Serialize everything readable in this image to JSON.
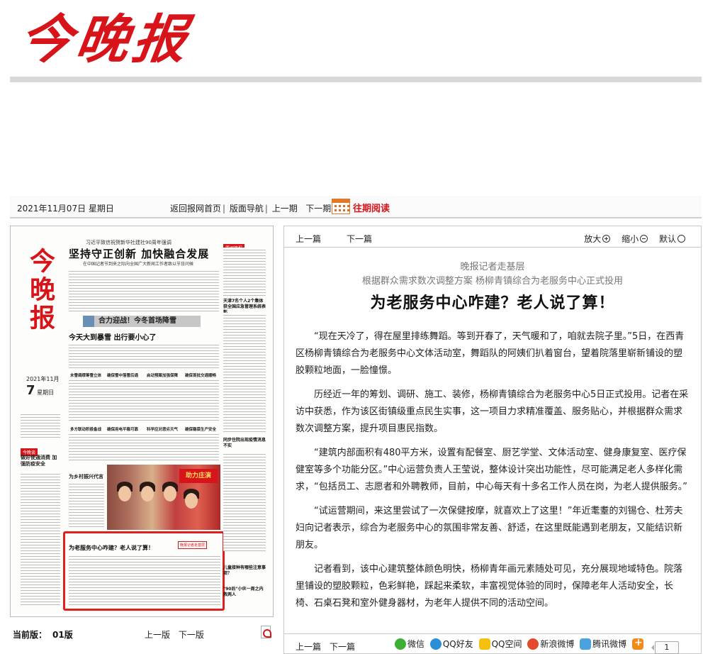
{
  "masthead": {
    "logo_text": "今晚报",
    "brand_color": "#d8141b"
  },
  "navbar": {
    "date": "2021年11月07日 星期日",
    "links": [
      "返回报网首页",
      "版面导航",
      "上一期",
      "下一期"
    ],
    "past_reading": "往期阅读",
    "calendar_icon": "calendar-icon"
  },
  "thumbnail": {
    "logo": "今晚报",
    "top_small": "习近平致信祝贺新华社建社90周年强调",
    "headline1": "坚持守正创新 加快融合发展",
    "sub1": "在中国记者节到来之际向全国广大新闻工作者致以节日问候",
    "banner": "合力迎战！今冬首场降雪",
    "headline2": "今天大到暴雪 出行要小心了",
    "small_heads": [
      "未雪绸缪筹雪立体",
      "确保雪中落雪后通",
      "启动预案加强保障",
      "确保首批交通顺畅",
      "多方联动积极备战",
      "确保用电平稳可靠",
      "科学应对恶劣天气",
      "确保稳菜生产安全"
    ],
    "date_month": "2021年11月",
    "date_day": "7",
    "weekday": "星期日",
    "left_tag": "今晚谈",
    "left_text": "做好使通消费 加强防疫安全",
    "photo_caption": "为乡村振兴代言",
    "photo_sign": "助力庄演",
    "hl_title": "为老服务中心咋建？老人说了算！",
    "hl_tag": "晚报记者走基层",
    "right_tag": "要闻简报",
    "right_heads": [
      "天津7名个人2个集体获全国应急管理系统表彰",
      "同步住院出现疫情消息不实",
      "儿童接种有哪些注意事项？",
      "\"90后\"小伙一周之内救两人"
    ]
  },
  "current_edition": {
    "label": "当前版：",
    "value": "01版"
  },
  "page_nav": [
    "上一版",
    "下一版"
  ],
  "article_nav": {
    "prev": "上一篇",
    "next": "下一篇"
  },
  "zoom": {
    "in": "放大",
    "out": "缩小",
    "default": "默认"
  },
  "article": {
    "kicker": "晚报记者走基层",
    "subtitle": "根据群众需求数次调整方案 杨柳青镇综合为老服务中心正式投用",
    "title": "为老服务中心咋建？老人说了算！",
    "paragraphs": [
      "“现在天冷了，得在屋里排练舞蹈。等到开春了，天气暖和了，咱就去院子里。”5日，在西青区杨柳青镇综合为老服务中心文体活动室，舞蹈队的阿姨们扒着窗台，望着院落里崭新铺设的塑胶颗粒地面，一脸憧憬。",
      "历经近一年的筹划、调研、施工、装修，杨柳青镇综合为老服务中心5日正式投用。记者在采访中获悉，作为该区街镇级重点民生实事，这一项目力求精准覆盖、服务贴心，并根据群众需求数次调整方案，提升项目惠民指数。",
      "“建筑内部面积有480平方米，设置有配餐室、厨艺学堂、文体活动室、健身康复室、医疗保健室等多个功能分区。”中心运营负责人王莹说，整体设计突出功能性，尽可能满足老人多样化需求，“包括员工、志愿者和外聘教师，目前，中心每天有十多名工作人员在岗，为老人提供服务。”",
      "“试运营期间，来这里尝试了一次保健按摩，就喜欢上了这里！”年近耄耋的刘锡仓、杜芳夫妇向记者表示，综合为老服务中心的氛围非常友善、舒适，在这里既能遇到老朋友，又能结识新朋友。",
      "记者看到，该中心建筑整体颜色明快，杨柳青年画元素随处可见，充分展现地域特色。院落里铺设的塑胶颗粒，色彩鲜艳，踩起来柔软，丰富视觉体验的同时，保障老年人活动安全，长椅、石桌石凳和室外健身器材，为老年人提供不同的活动空间。"
    ]
  },
  "share": {
    "items": [
      "微信",
      "QQ好友",
      "QQ空间",
      "新浪微博",
      "腾讯微博"
    ],
    "count": "1"
  }
}
